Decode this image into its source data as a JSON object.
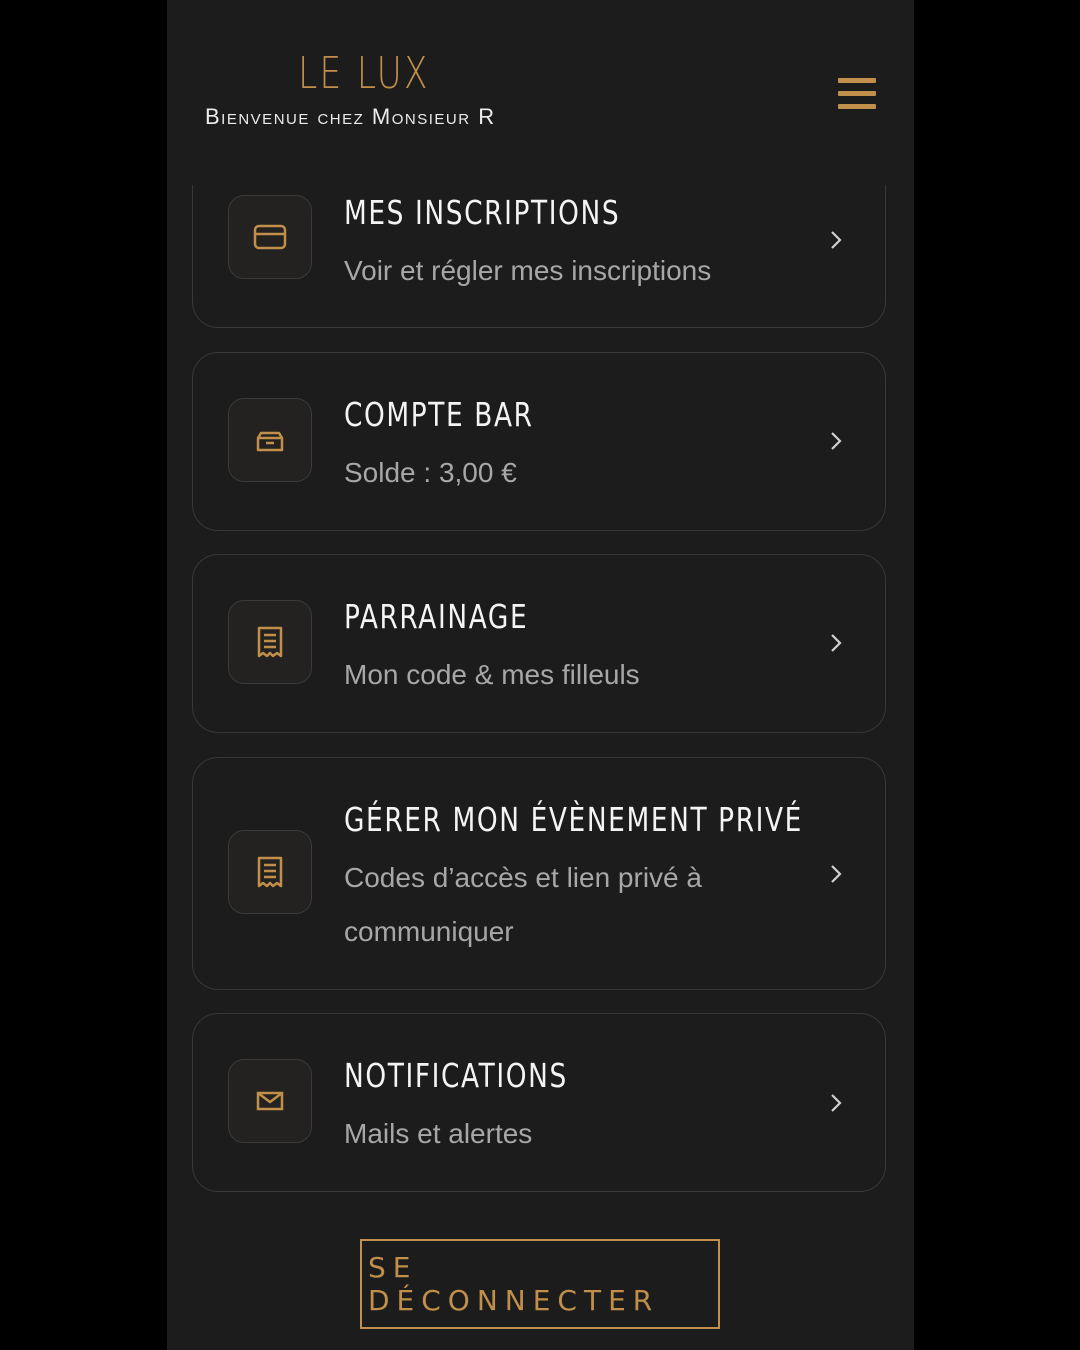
{
  "header": {
    "logo": "LE LUX",
    "tagline": "Bienvenue chez Monsieur R",
    "menu_icon": "hamburger-menu-icon"
  },
  "colors": {
    "accent": "#c18f4a",
    "background": "#1c1c1c",
    "card_border": "#383838",
    "title": "#f4f4f4",
    "subtitle": "#a7a7a7"
  },
  "menu_items": [
    {
      "title": "MES INSCRIPTIONS",
      "subtitle": "Voir et régler mes inscriptions",
      "icon": "credit-card-icon"
    },
    {
      "title": "COMPTE BAR",
      "subtitle": "Solde : 3,00 €",
      "icon": "wallet-icon"
    },
    {
      "title": "PARRAINAGE",
      "subtitle": "Mon code & mes filleuls",
      "icon": "receipt-icon"
    },
    {
      "title": "GÉRER MON ÉVÈNEMENT PRIVÉ",
      "subtitle": "Codes d’accès et lien privé à communiquer",
      "icon": "receipt-icon"
    },
    {
      "title": "NOTIFICATIONS",
      "subtitle": "Mails et alertes",
      "icon": "mail-icon"
    }
  ],
  "logout_label": "SE DÉCONNECTER"
}
